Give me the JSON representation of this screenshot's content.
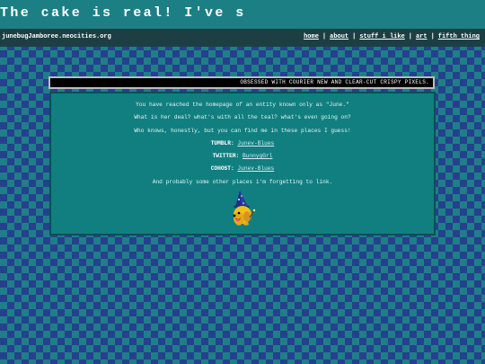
{
  "marquee": {
    "text": "The cake is real! I've s"
  },
  "navbar": {
    "site_name": "junebugJamboree.neocities.org",
    "links": [
      "home",
      "about",
      "stuff i like",
      "art",
      "fifth thing"
    ],
    "separator": "|"
  },
  "tagline": {
    "text": "OBSESSED WITH COURIER NEW AND CLEAR-CUT CRISPY PIXELS."
  },
  "intro": {
    "line1": "You have reached the homepage of an entity known only as \"June.\"",
    "line2": "What is her deal? what's with all the teal? what's even going on?",
    "line3": "Who knows, honestly, but you can find me in these places I guess!"
  },
  "socials": [
    {
      "label": "TUMBLR:",
      "handle": "Junev-Blues"
    },
    {
      "label": "TWITTER:",
      "handle": "BunnygGrl"
    },
    {
      "label": "COHOST:",
      "handle": "Junev-Blues"
    }
  ],
  "outro": "And probably some other places i'm forgetting to link.",
  "colors": {
    "teal_bg": "#1e7f86",
    "diamond_blue": "#26408f",
    "navbar": "#1d3f44",
    "content_box": "#117f80"
  },
  "mascot_icon": "wizard-dog-icon"
}
